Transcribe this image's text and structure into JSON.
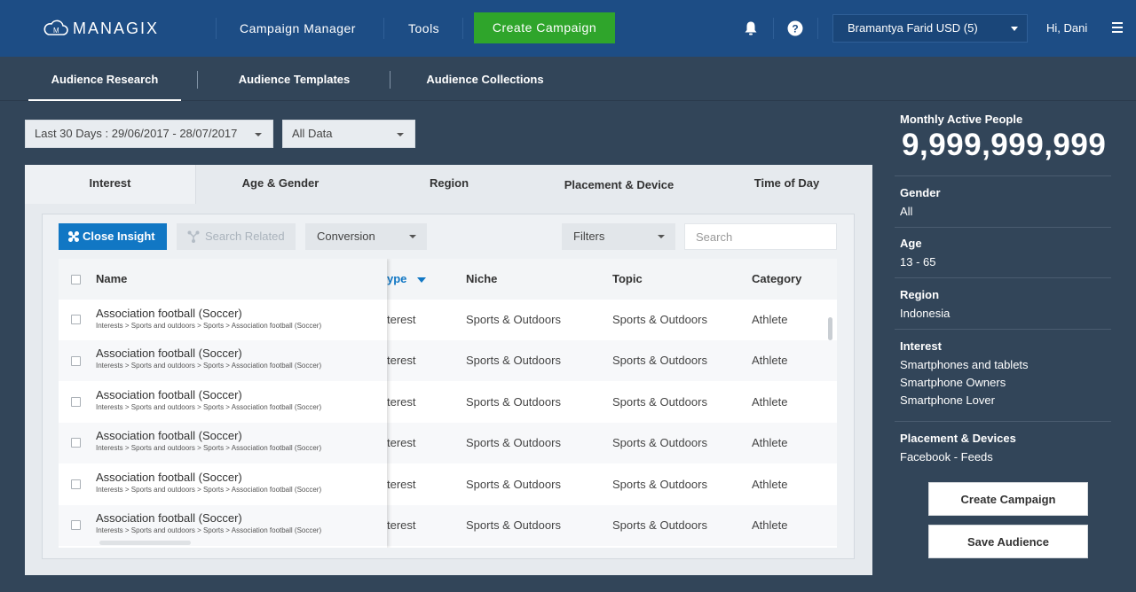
{
  "header": {
    "logo_text": "MANAGIX",
    "nav": [
      "Campaign Manager",
      "Tools"
    ],
    "create_button": "Create Campaign",
    "account": "Bramantya Farid USD (5)",
    "greeting": "Hi, Dani",
    "icons": [
      "bell-icon",
      "help-icon",
      "menu-icon"
    ]
  },
  "subnav": {
    "tabs": [
      "Audience Research",
      "Audience Templates",
      "Audience Collections"
    ],
    "active": "Audience Research"
  },
  "filters": {
    "date_range": "Last 30 Days : 29/06/2017 - 28/07/2017",
    "data_scope": "All Data"
  },
  "panel": {
    "tabs": [
      "Interest",
      "Age & Gender",
      "Region",
      "Placement & Device",
      "Time of Day"
    ],
    "active_tab": "Interest",
    "toolbar": {
      "close_insight": "Close Insight",
      "search_related": "Search Related",
      "conversion": "Conversion",
      "filters": "Filters",
      "search_placeholder": "Search"
    },
    "table": {
      "columns": [
        "Name",
        "ype",
        "Niche",
        "Topic",
        "Category"
      ],
      "rows": [
        {
          "name": "Association football (Soccer)",
          "path": "Interests > Sports and outdoors > Sports > Association football (Soccer)",
          "type": "terest",
          "niche": "Sports & Outdoors",
          "topic": "Sports & Outdoors",
          "category": "Athlete"
        },
        {
          "name": "Association football (Soccer)",
          "path": "Interests > Sports and outdoors > Sports > Association football (Soccer)",
          "type": "terest",
          "niche": "Sports & Outdoors",
          "topic": "Sports & Outdoors",
          "category": "Athlete"
        },
        {
          "name": "Association football (Soccer)",
          "path": "Interests > Sports and outdoors > Sports > Association football (Soccer)",
          "type": "terest",
          "niche": "Sports & Outdoors",
          "topic": "Sports & Outdoors",
          "category": "Athlete"
        },
        {
          "name": "Association football (Soccer)",
          "path": "Interests > Sports and outdoors > Sports > Association football (Soccer)",
          "type": "terest",
          "niche": "Sports & Outdoors",
          "topic": "Sports & Outdoors",
          "category": "Athlete"
        },
        {
          "name": "Association football (Soccer)",
          "path": "Interests > Sports and outdoors > Sports > Association football (Soccer)",
          "type": "terest",
          "niche": "Sports & Outdoors",
          "topic": "Sports & Outdoors",
          "category": "Athlete"
        },
        {
          "name": "Association football (Soccer)",
          "path": "Interests > Sports and outdoors > Sports > Association football (Soccer)",
          "type": "terest",
          "niche": "Sports & Outdoors",
          "topic": "Sports & Outdoors",
          "category": "Athlete"
        }
      ]
    }
  },
  "sidebar": {
    "map_label": "Monthly Active People",
    "map_value": "9,999,999,999",
    "sections": [
      {
        "label": "Gender",
        "values": [
          "All"
        ]
      },
      {
        "label": "Age",
        "values": [
          "13 - 65"
        ]
      },
      {
        "label": "Region",
        "values": [
          "Indonesia"
        ]
      },
      {
        "label": "Interest",
        "values": [
          "Smartphones and tablets",
          "Smartphone Owners",
          "Smartphone Lover"
        ]
      },
      {
        "label": "Placement & Devices",
        "values": [
          "Facebook - Feeds"
        ]
      }
    ],
    "buttons": [
      "Create Campaign",
      "Save Audience"
    ]
  },
  "colors": {
    "header_bg": "#1d4d85",
    "page_bg": "#324559",
    "accent_green": "#2fa52b",
    "accent_blue": "#1177c4"
  }
}
